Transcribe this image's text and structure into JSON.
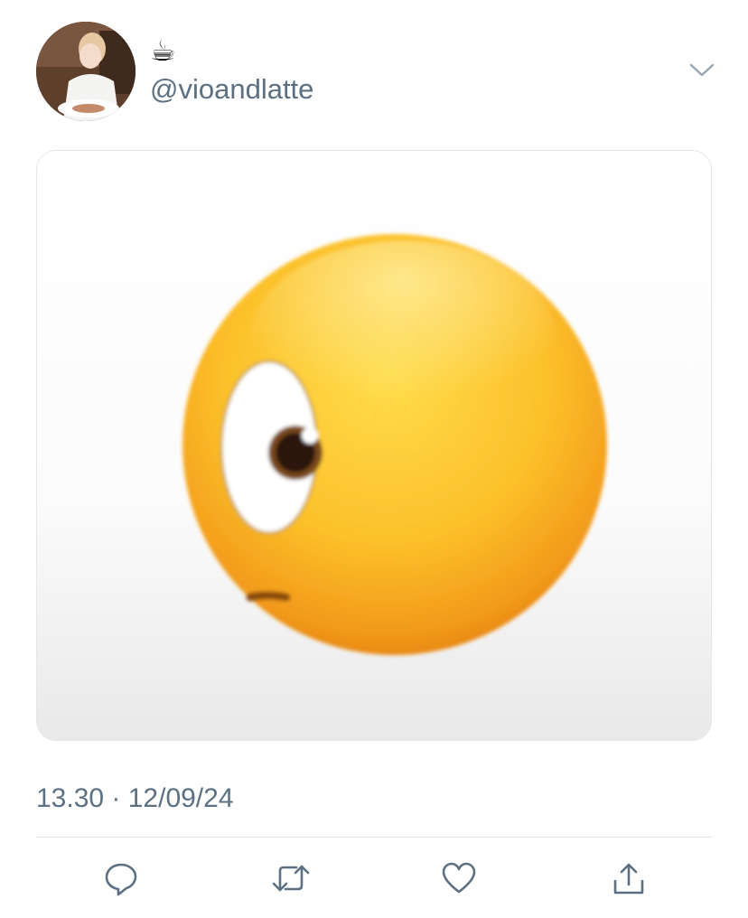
{
  "tweet": {
    "display_name": "☕",
    "handle": "@vioandlatte",
    "timestamp": "13.30 · 12/09/24"
  },
  "icons": {
    "avatar": "user-avatar",
    "menu": "chevron-down-icon",
    "reply": "reply-icon",
    "retweet": "retweet-icon",
    "like": "heart-icon",
    "share": "share-icon",
    "media": "face-with-rolling-eye-emoji"
  },
  "colors": {
    "secondary_text": "#5b7083",
    "icon": "#5b7083",
    "divider": "#dfe4e8"
  }
}
